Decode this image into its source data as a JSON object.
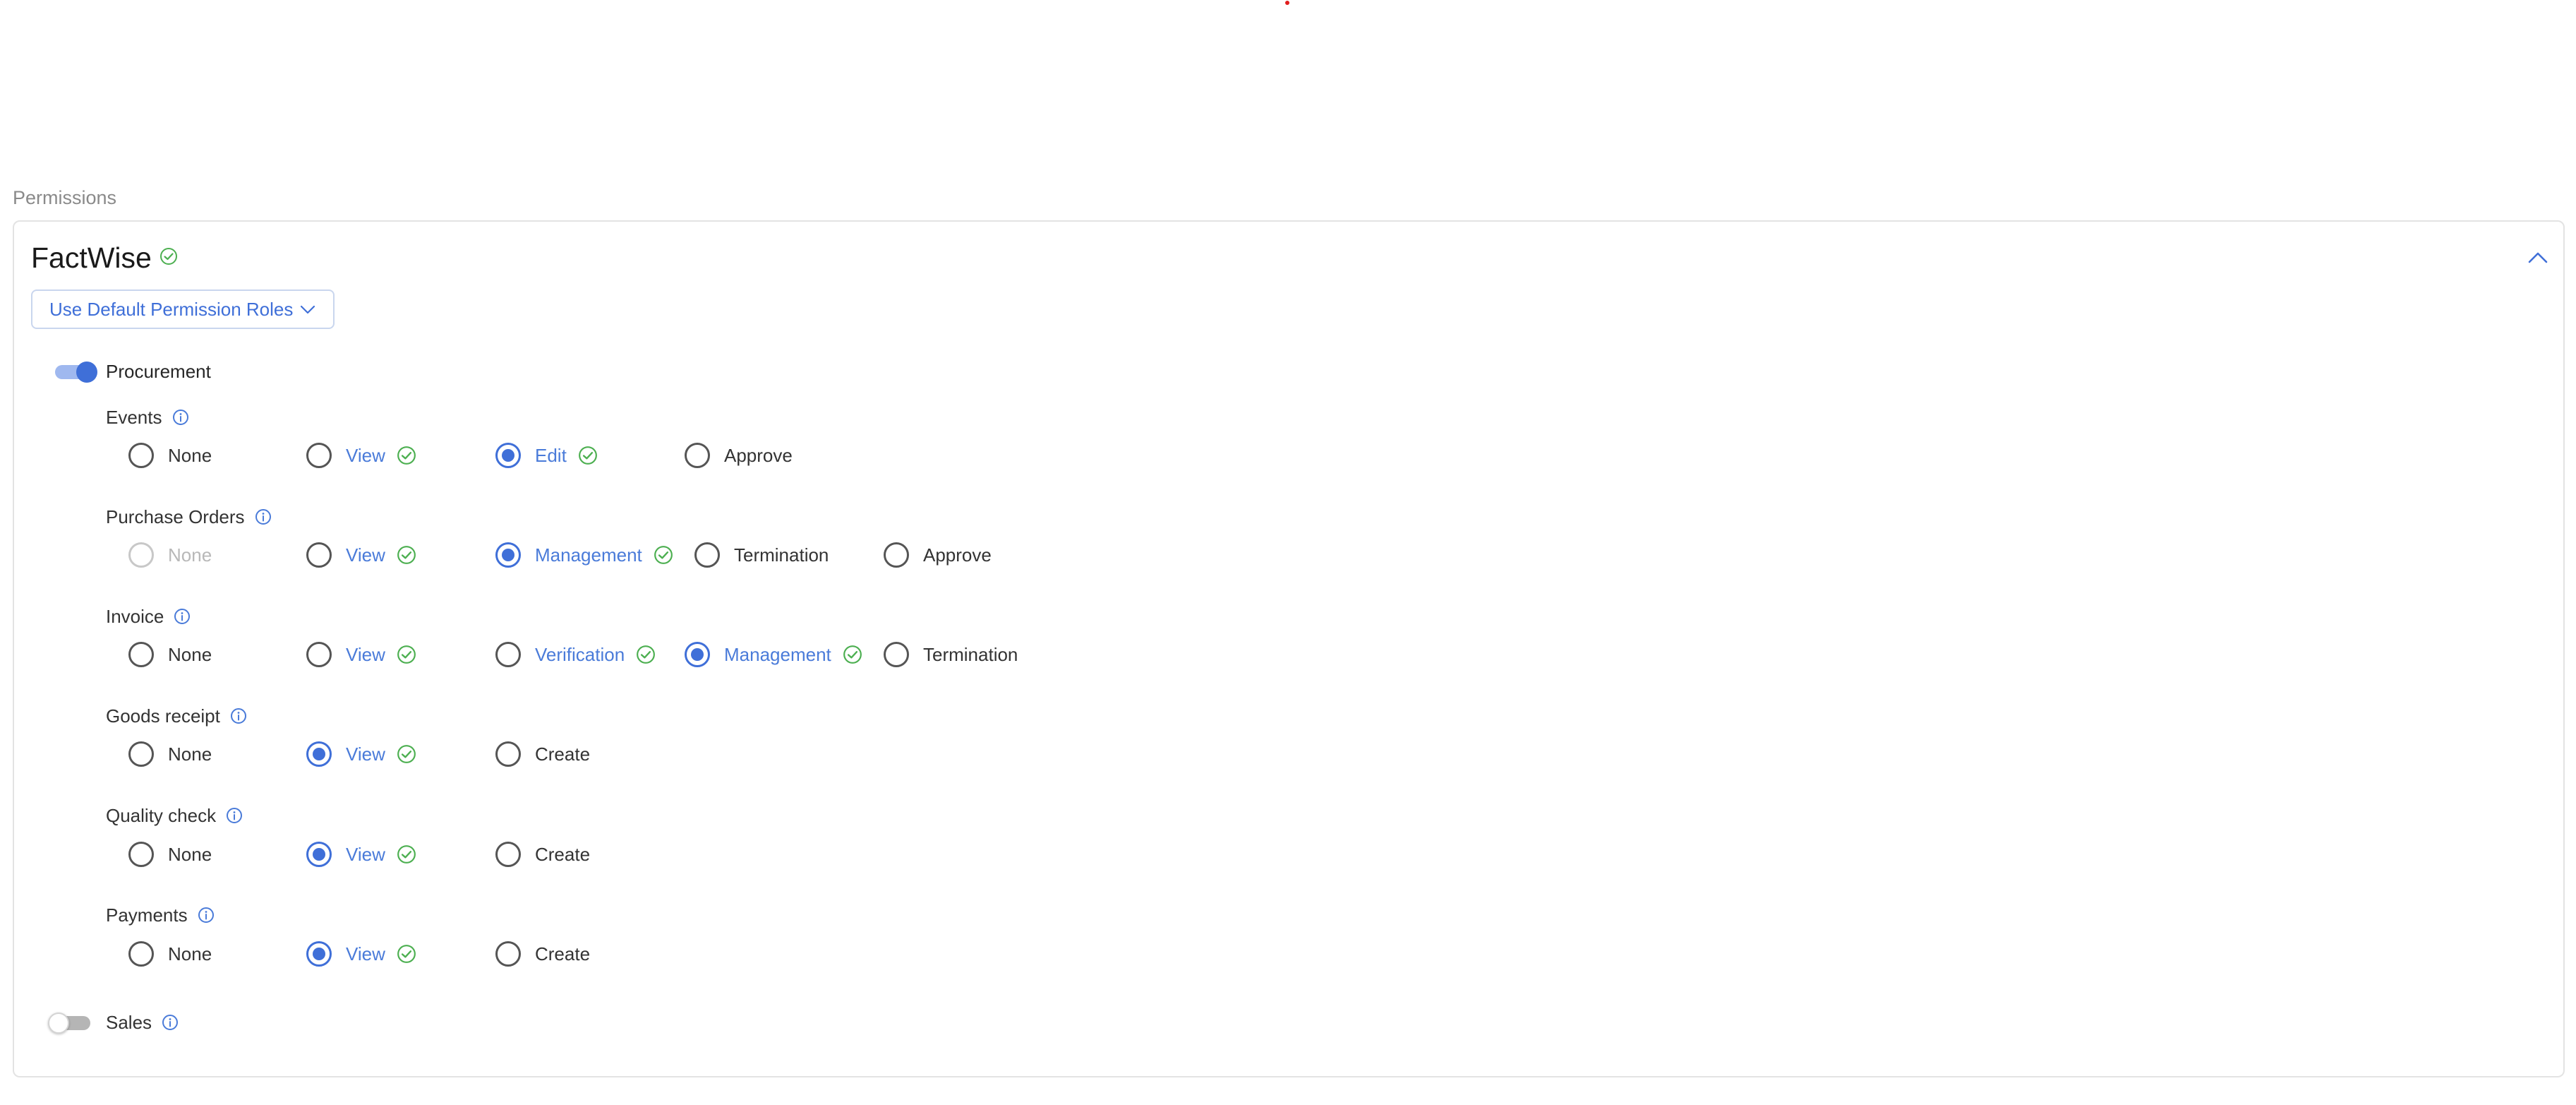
{
  "section_label": "Permissions",
  "card": {
    "title": "FactWise",
    "default_roles_label": "Use Default Permission Roles"
  },
  "colors": {
    "accent": "#3f6fd8",
    "success": "#4caf50",
    "border": "#e3e3e3"
  },
  "modules": {
    "procurement": {
      "label": "Procurement",
      "enabled": true,
      "groups": {
        "events": {
          "label": "Events",
          "options": [
            "None",
            "View",
            "Edit",
            "Approve"
          ]
        },
        "purchase_orders": {
          "label": "Purchase Orders",
          "options": [
            "None",
            "View",
            "Management",
            "Termination",
            "Approve"
          ]
        },
        "invoice": {
          "label": "Invoice",
          "options": [
            "None",
            "View",
            "Verification",
            "Management",
            "Termination"
          ]
        },
        "goods_receipt": {
          "label": "Goods receipt",
          "options": [
            "None",
            "View",
            "Create"
          ]
        },
        "quality_check": {
          "label": "Quality check",
          "options": [
            "None",
            "View",
            "Create"
          ]
        },
        "payments": {
          "label": "Payments",
          "options": [
            "None",
            "View",
            "Create"
          ]
        }
      }
    },
    "sales": {
      "label": "Sales",
      "enabled": false
    }
  }
}
